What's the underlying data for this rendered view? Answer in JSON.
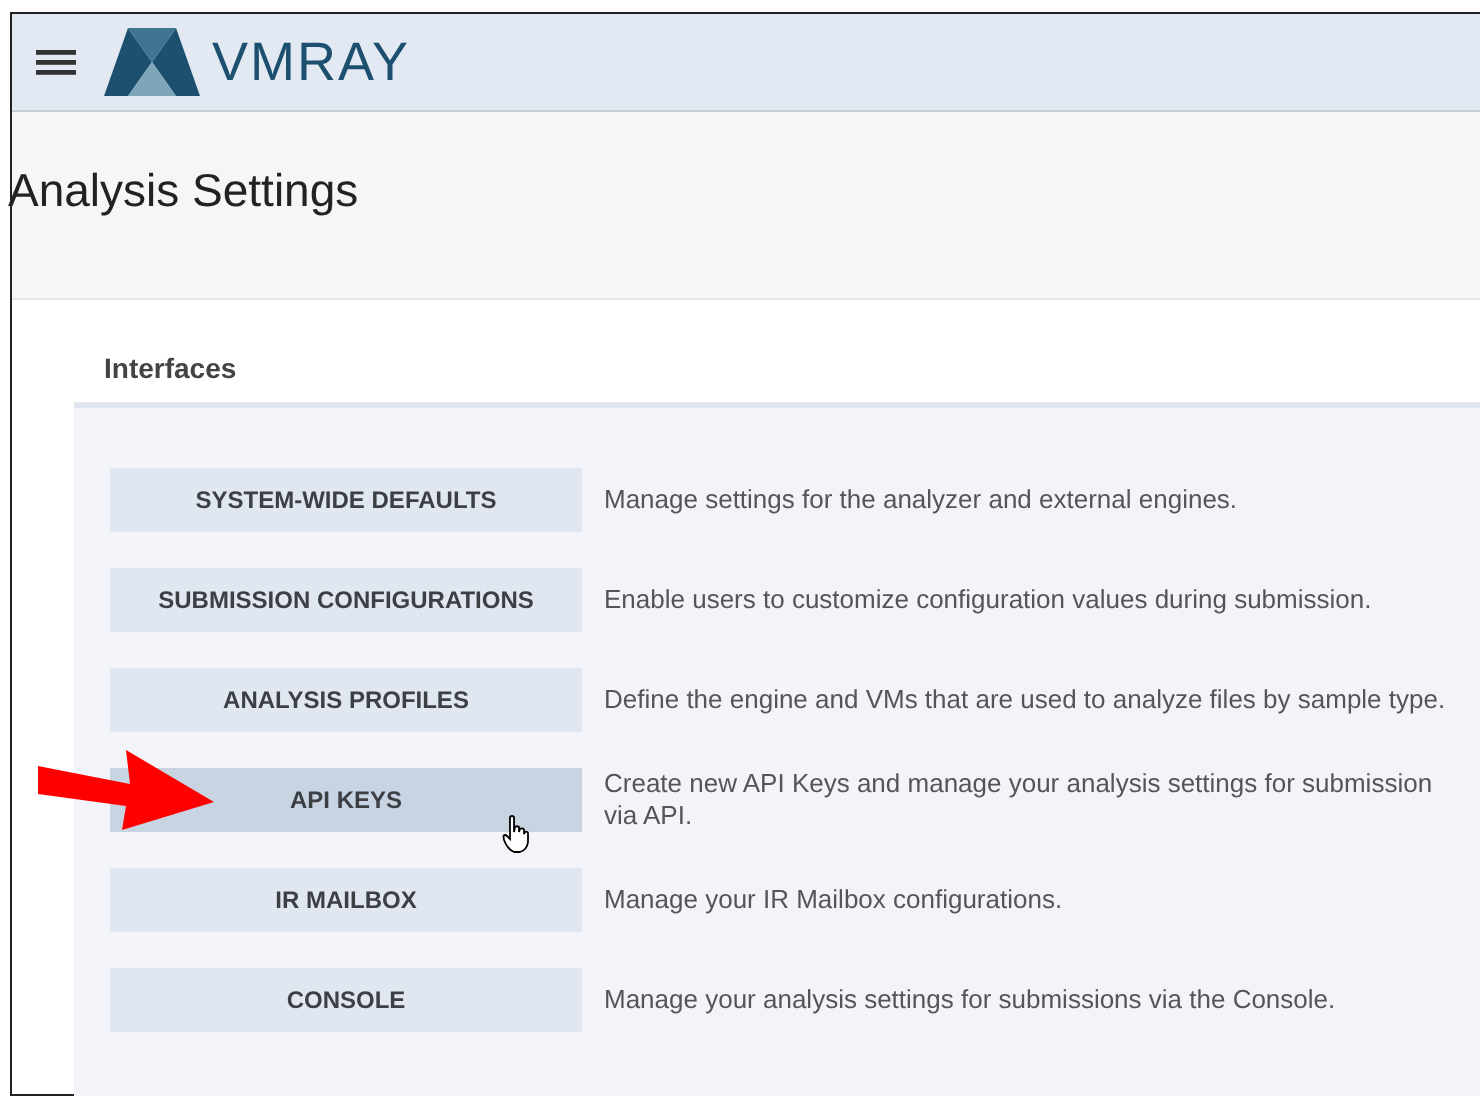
{
  "header": {
    "brand": "VMRAY"
  },
  "page": {
    "title": "Analysis Settings"
  },
  "section": {
    "heading": "Interfaces"
  },
  "items": [
    {
      "label": "SYSTEM-WIDE DEFAULTS",
      "description": "Manage settings for the analyzer and external engines.",
      "hovered": false
    },
    {
      "label": "SUBMISSION CONFIGURATIONS",
      "description": "Enable users to customize configuration values during submission.",
      "hovered": false
    },
    {
      "label": "ANALYSIS PROFILES",
      "description": "Define the engine and VMs that are used to analyze files by sample type.",
      "hovered": false
    },
    {
      "label": "API KEYS",
      "description": "Create new API Keys and manage your analysis settings for submission via API.",
      "hovered": true
    },
    {
      "label": "IR MAILBOX",
      "description": "Manage your IR Mailbox configurations.",
      "hovered": false
    },
    {
      "label": "CONSOLE",
      "description": "Manage your analysis settings for submissions via the Console.",
      "hovered": false
    }
  ]
}
